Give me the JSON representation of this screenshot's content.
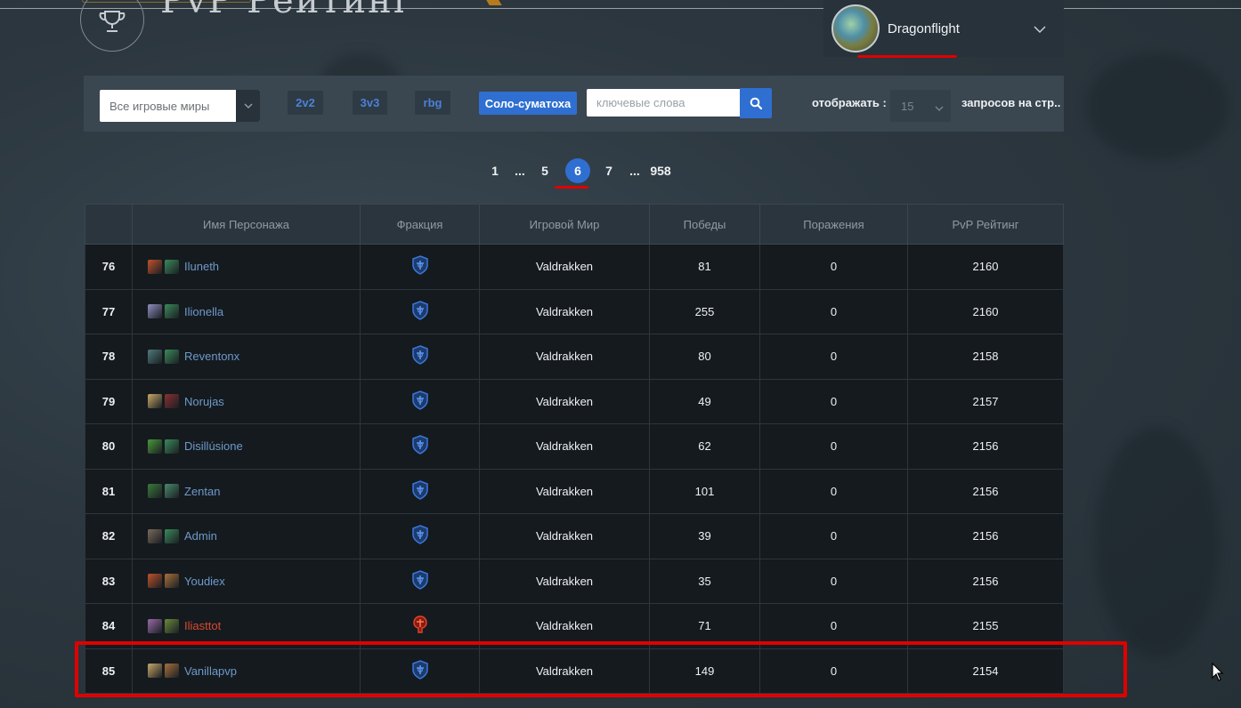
{
  "header": {
    "page_title": "PvP Рейтинг",
    "realm": {
      "name": "Dragonflight"
    }
  },
  "filters": {
    "world_select": "Все игровые миры",
    "modes": [
      {
        "label": "2v2",
        "active": false
      },
      {
        "label": "3v3",
        "active": false
      },
      {
        "label": "rbg",
        "active": false
      },
      {
        "label": "Соло-суматоха",
        "active": true
      }
    ],
    "keyword_placeholder": "ключевые слова",
    "show_label": "отображать :",
    "per_page_value": "15",
    "per_page_label": "запросов на стр.."
  },
  "pagination": {
    "items": [
      "1",
      "...",
      "5",
      "6",
      "7",
      "...",
      "958"
    ],
    "active": "6"
  },
  "table": {
    "headers": [
      "",
      "Имя Персонажа",
      "Фракция",
      "Игровой Мир",
      "Победы",
      "Поражения",
      "PvP Рейтинг"
    ],
    "rows": [
      {
        "rank": "76",
        "name": "Iluneth",
        "faction": "alliance",
        "realm": "Valdrakken",
        "wins": "81",
        "losses": "0",
        "rating": "2160",
        "icons": [
          "#c0522a",
          "#3b8a5a"
        ]
      },
      {
        "rank": "77",
        "name": "Ilionella",
        "faction": "alliance",
        "realm": "Valdrakken",
        "wins": "255",
        "losses": "0",
        "rating": "2160",
        "icons": [
          "#8f8fbf",
          "#3b8a5a"
        ]
      },
      {
        "rank": "78",
        "name": "Reventonx",
        "faction": "alliance",
        "realm": "Valdrakken",
        "wins": "80",
        "losses": "0",
        "rating": "2158",
        "icons": [
          "#4f7a7a",
          "#3b8a5a"
        ]
      },
      {
        "rank": "79",
        "name": "Norujas",
        "faction": "alliance",
        "realm": "Valdrakken",
        "wins": "49",
        "losses": "0",
        "rating": "2157",
        "icons": [
          "#c8a869",
          "#8a3030"
        ]
      },
      {
        "rank": "80",
        "name": "Disillúsione",
        "faction": "alliance",
        "realm": "Valdrakken",
        "wins": "62",
        "losses": "0",
        "rating": "2156",
        "icons": [
          "#4a9a3a",
          "#3b8a5a"
        ]
      },
      {
        "rank": "81",
        "name": "Zentan",
        "faction": "alliance",
        "realm": "Valdrakken",
        "wins": "101",
        "losses": "0",
        "rating": "2156",
        "icons": [
          "#3a7a3a",
          "#4a8a6a"
        ]
      },
      {
        "rank": "82",
        "name": "Admin",
        "faction": "alliance",
        "realm": "Valdrakken",
        "wins": "39",
        "losses": "0",
        "rating": "2156",
        "icons": [
          "#7a6a5a",
          "#3b8a5a"
        ]
      },
      {
        "rank": "83",
        "name": "Youdiex",
        "faction": "alliance",
        "realm": "Valdrakken",
        "wins": "35",
        "losses": "0",
        "rating": "2156",
        "icons": [
          "#c0522a",
          "#a8703a"
        ]
      },
      {
        "rank": "84",
        "name": "Iliasttot",
        "faction": "horde",
        "realm": "Valdrakken",
        "wins": "71",
        "losses": "0",
        "rating": "2155",
        "icons": [
          "#9a6aa8",
          "#6a8a3a"
        ]
      },
      {
        "rank": "85",
        "name": "Vanillapvp",
        "faction": "alliance",
        "realm": "Valdrakken",
        "wins": "149",
        "losses": "0",
        "rating": "2154",
        "icons": [
          "#c8a869",
          "#a8703a"
        ]
      }
    ]
  },
  "colors": {
    "accent": "#2f6fd1",
    "annotation_red": "#e00000",
    "alliance": "#2f6fd1",
    "horde": "#d9492e"
  }
}
